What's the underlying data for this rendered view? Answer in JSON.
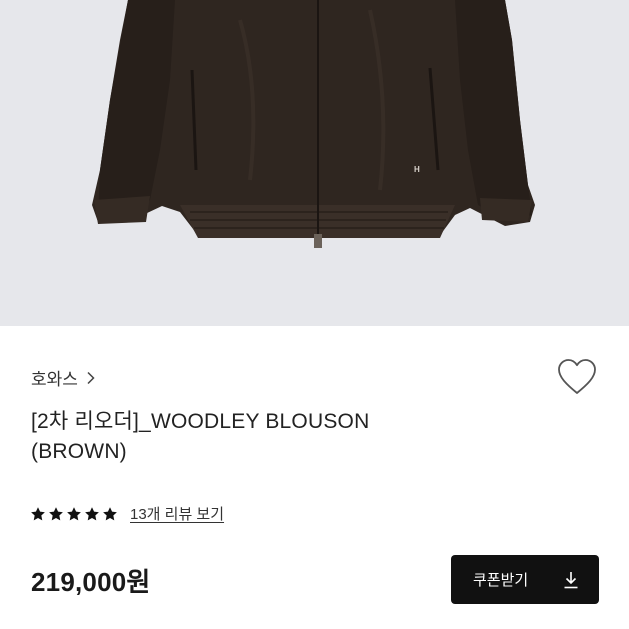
{
  "product": {
    "image_icon": "jacket-photo",
    "brand": "호와스",
    "brand_arrow_icon": "chevron-right-icon",
    "wishlist_icon": "heart-outline-icon",
    "title": "[2차 리오더]_WOODLEY BLOUSON (BROWN)",
    "rating": {
      "stars": 5,
      "max": 5,
      "review_link": "13개 리뷰 보기"
    },
    "price": "219,000원",
    "coupon_button": {
      "label": "쿠폰받기",
      "icon": "download-icon"
    }
  },
  "colors": {
    "accent": "#111111",
    "background": "#ffffff",
    "hero_bg": "#e6e7eb",
    "jacket": "#2f2620"
  }
}
